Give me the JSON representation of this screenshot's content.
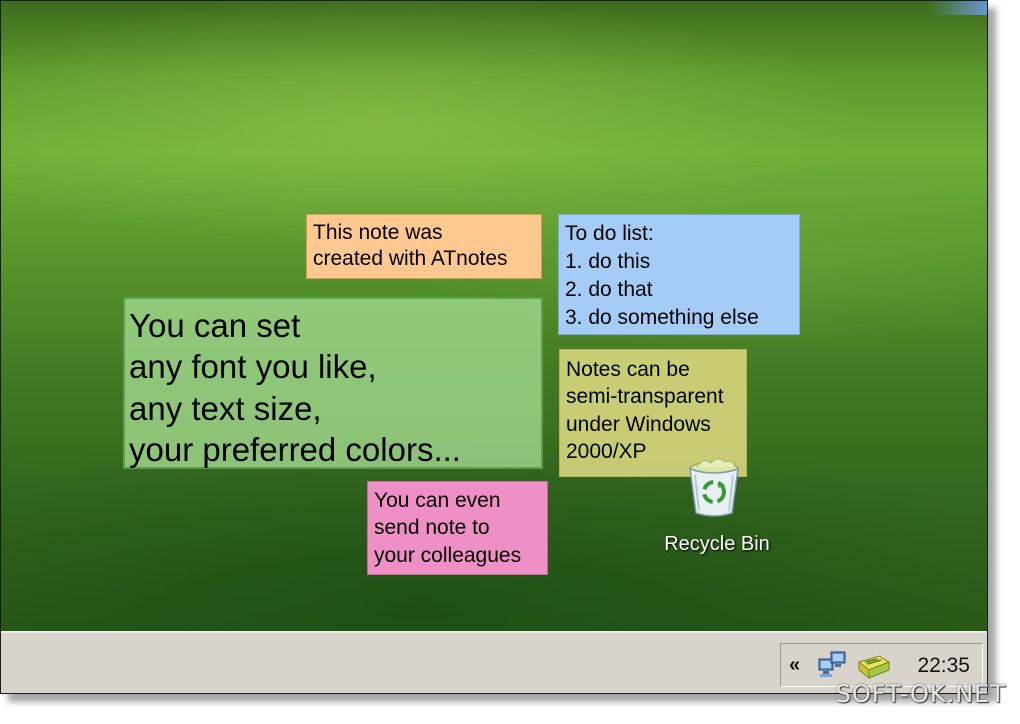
{
  "desktop": {
    "notes": [
      {
        "text": "This note was\ncreated with ATnotes",
        "color": "#ffc891"
      },
      {
        "text": "To do list:\n1. do this\n2. do that\n3. do something else",
        "color": "#a5ccf6"
      },
      {
        "text": "You can set\nany font you like,\nany text size,\nyour preferred colors...",
        "color": "#a0d78c"
      },
      {
        "text": "Notes can be\nsemi-transparent\nunder Windows\n2000/XP",
        "color": "#e1dc82"
      },
      {
        "text": "You can even\nsend note to\nyour colleagues",
        "color": "#ee90c5"
      }
    ],
    "recycle_bin": {
      "label": "Recycle Bin",
      "icon": "recycle-bin-icon"
    }
  },
  "taskbar": {
    "tray": {
      "chevron": "«",
      "icons": [
        "network-connections-icon",
        "atnotes-tray-icon"
      ],
      "clock": "22:35"
    }
  },
  "watermark": "SOFT-OK.NET"
}
